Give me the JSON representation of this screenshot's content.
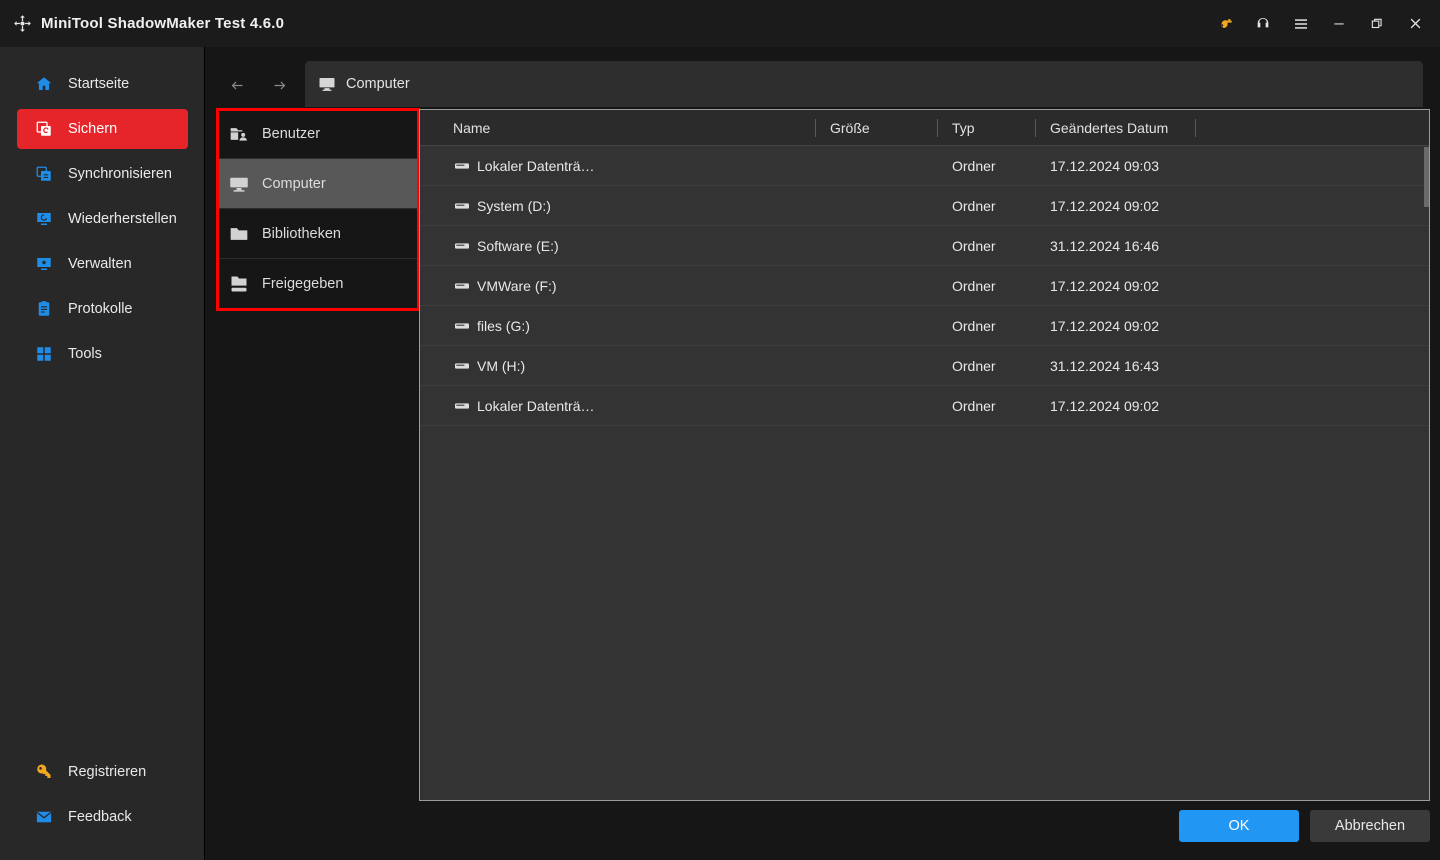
{
  "window": {
    "title": "MiniTool ShadowMaker Test 4.6.0",
    "logo_icon": "shadowmaker-logo-icon",
    "controls": [
      {
        "name": "key-icon",
        "glyph": "key"
      },
      {
        "name": "headset-icon",
        "glyph": "headset"
      },
      {
        "name": "menu-icon",
        "glyph": "hamburger"
      },
      {
        "name": "minimize-icon",
        "glyph": "minimize"
      },
      {
        "name": "maximize-icon",
        "glyph": "restore"
      },
      {
        "name": "close-icon",
        "glyph": "close"
      }
    ]
  },
  "sidebar": {
    "items": [
      {
        "label": "Startseite",
        "icon": "home-icon",
        "active": false
      },
      {
        "label": "Sichern",
        "icon": "backup-icon",
        "active": true
      },
      {
        "label": "Synchronisieren",
        "icon": "sync-icon",
        "active": false
      },
      {
        "label": "Wiederherstellen",
        "icon": "restore-icon",
        "active": false
      },
      {
        "label": "Verwalten",
        "icon": "manage-icon",
        "active": false
      },
      {
        "label": "Protokolle",
        "icon": "logs-icon",
        "active": false
      },
      {
        "label": "Tools",
        "icon": "tools-icon",
        "active": false
      }
    ],
    "bottom_items": [
      {
        "label": "Registrieren",
        "icon": "key-icon"
      },
      {
        "label": "Feedback",
        "icon": "mail-icon"
      }
    ]
  },
  "dialog": {
    "nav": {
      "back_icon": "arrow-left-icon",
      "forward_icon": "arrow-right-icon",
      "breadcrumb_icon": "computer-icon",
      "breadcrumb_label": "Computer"
    },
    "tree": {
      "items": [
        {
          "label": "Benutzer",
          "icon": "users-folder-icon",
          "selected": false
        },
        {
          "label": "Computer",
          "icon": "monitor-icon",
          "selected": true
        },
        {
          "label": "Bibliotheken",
          "icon": "folder-icon",
          "selected": false
        },
        {
          "label": "Freigegeben",
          "icon": "shared-folder-icon",
          "selected": false
        }
      ]
    },
    "file_list": {
      "columns": [
        "Name",
        "Größe",
        "Typ",
        "Geändertes Datum"
      ],
      "rows": [
        {
          "name": "Lokaler Datenträ…",
          "size": "",
          "type": "Ordner",
          "modified": "17.12.2024 09:03",
          "icon": "drive-icon"
        },
        {
          "name": "System (D:)",
          "size": "",
          "type": "Ordner",
          "modified": "17.12.2024 09:02",
          "icon": "drive-icon"
        },
        {
          "name": "Software (E:)",
          "size": "",
          "type": "Ordner",
          "modified": "31.12.2024 16:46",
          "icon": "drive-icon"
        },
        {
          "name": "VMWare (F:)",
          "size": "",
          "type": "Ordner",
          "modified": "17.12.2024 09:02",
          "icon": "drive-icon"
        },
        {
          "name": "files (G:)",
          "size": "",
          "type": "Ordner",
          "modified": "17.12.2024 09:02",
          "icon": "drive-icon"
        },
        {
          "name": "VM (H:)",
          "size": "",
          "type": "Ordner",
          "modified": "31.12.2024 16:43",
          "icon": "drive-icon"
        },
        {
          "name": "Lokaler Datenträ…",
          "size": "",
          "type": "Ordner",
          "modified": "17.12.2024 09:02",
          "icon": "drive-icon"
        }
      ]
    },
    "footer": {
      "ok_label": "OK",
      "cancel_label": "Abbrechen"
    }
  },
  "annotation": {
    "type": "highlight-rectangle",
    "color": "#ff0000"
  },
  "colors": {
    "accent_red": "#e5252a",
    "accent_blue": "#2196f3",
    "icon_blue": "#1f8ce8",
    "icon_yellow": "#f0a91e",
    "window_bg": "#161616",
    "sidebar_bg": "#282828",
    "panel_bg": "#333333"
  }
}
